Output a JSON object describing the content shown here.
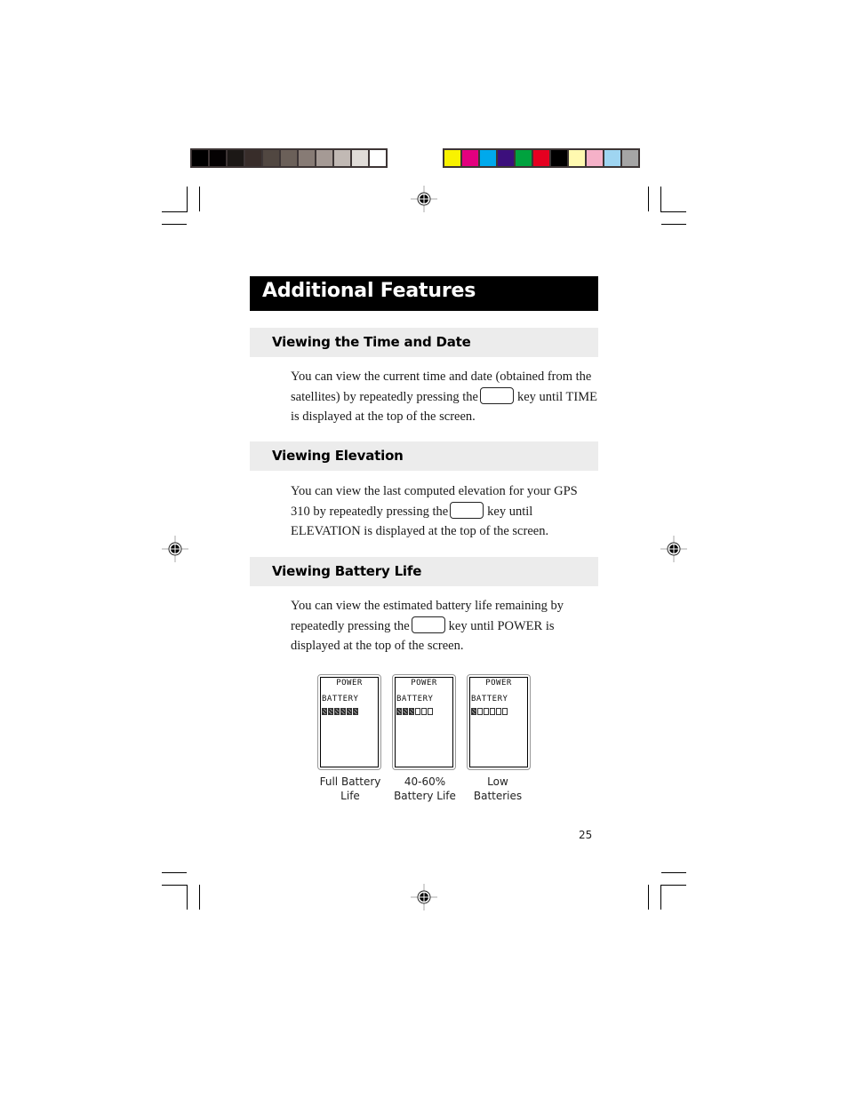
{
  "calibration": {
    "grayscale": [
      "#000000",
      "#050203",
      "#1c1816",
      "#382d2a",
      "#514741",
      "#6b6059",
      "#877b75",
      "#a59a95",
      "#c1b9b4",
      "#e0dcd8",
      "#ffffff"
    ],
    "colors": [
      "#f9f200",
      "#e4007f",
      "#00a9ec",
      "#3c0f7c",
      "#00a23e",
      "#e50020",
      "#000000",
      "#fff9b0",
      "#f5b1c8",
      "#9fd5f1",
      "#a5a5a5"
    ]
  },
  "page": {
    "title": "Additional Features",
    "sections": [
      {
        "heading": "Viewing the Time and Date",
        "before_key": "You can view the current time and date (obtained from the satellites) by repeatedly pressing the",
        "after_key": "key until TIME is displayed at the top of the screen."
      },
      {
        "heading": "Viewing Elevation",
        "before_key": "You can view the last computed elevation for your GPS 310 by repeatedly pressing the",
        "after_key": "key until ELEVATION is displayed at the top of the screen."
      },
      {
        "heading": "Viewing Battery Life",
        "before_key": "You can view the estimated battery life remaining by repeatedly pressing the",
        "after_key": "key until POWER is displayed at the top of the screen."
      }
    ],
    "screens": [
      {
        "title": "POWER",
        "label": "BATTERY",
        "segments_total": 6,
        "segments_filled": 6,
        "caption_line1": "Full Battery",
        "caption_line2": "Life"
      },
      {
        "title": "POWER",
        "label": "BATTERY",
        "segments_total": 6,
        "segments_filled": 3,
        "caption_line1": "40-60%",
        "caption_line2": "Battery Life"
      },
      {
        "title": "POWER",
        "label": "BATTERY",
        "segments_total": 6,
        "segments_filled": 1,
        "caption_line1": "Low",
        "caption_line2": "Batteries"
      }
    ],
    "page_number": "25"
  }
}
